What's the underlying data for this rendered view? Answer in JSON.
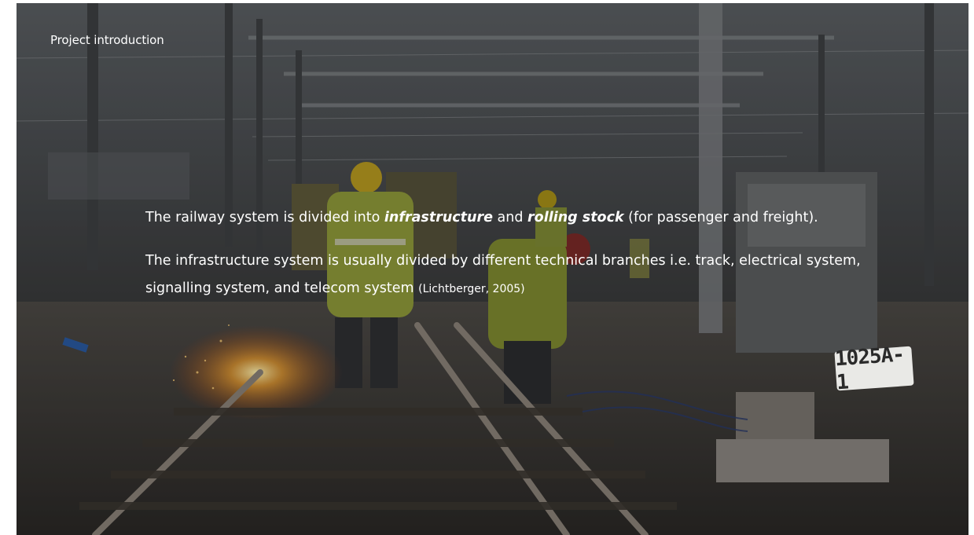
{
  "slide": {
    "section_title": "Project introduction",
    "paragraph1": {
      "text_a": "The railway system is divided into ",
      "bold_1": "infrastructure",
      "text_b": " and ",
      "bold_2": "rolling stock",
      "text_c": " (for passenger and freight)."
    },
    "paragraph2": {
      "text": "The infrastructure system is usually divided by different technical branches i.e. track, electrical system, signalling system, and telecom system ",
      "citation": "(Lichtberger, 2005)"
    },
    "background": {
      "sign_label": "1025A-1"
    }
  }
}
